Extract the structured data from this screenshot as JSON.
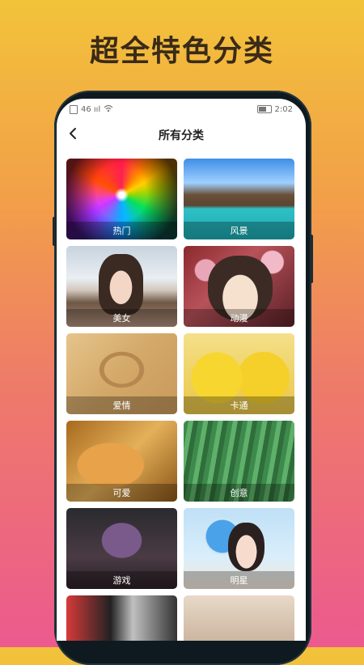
{
  "promo": {
    "title": "超全特色分类"
  },
  "status_bar": {
    "left": "46 ııl",
    "time": "2:02"
  },
  "app_bar": {
    "title": "所有分类",
    "back_icon": "chevron-left-icon"
  },
  "categories": [
    {
      "label": "热门"
    },
    {
      "label": "风景"
    },
    {
      "label": "美女"
    },
    {
      "label": "动漫"
    },
    {
      "label": "爱情"
    },
    {
      "label": "卡通"
    },
    {
      "label": "可爱"
    },
    {
      "label": "创意"
    },
    {
      "label": "游戏"
    },
    {
      "label": "明星"
    }
  ],
  "colors": {
    "background_top": "#f2c33a",
    "background_bottom": "#ec5a8e",
    "promo_text": "#3a2a18",
    "phone_frame": "#0e1a20"
  }
}
